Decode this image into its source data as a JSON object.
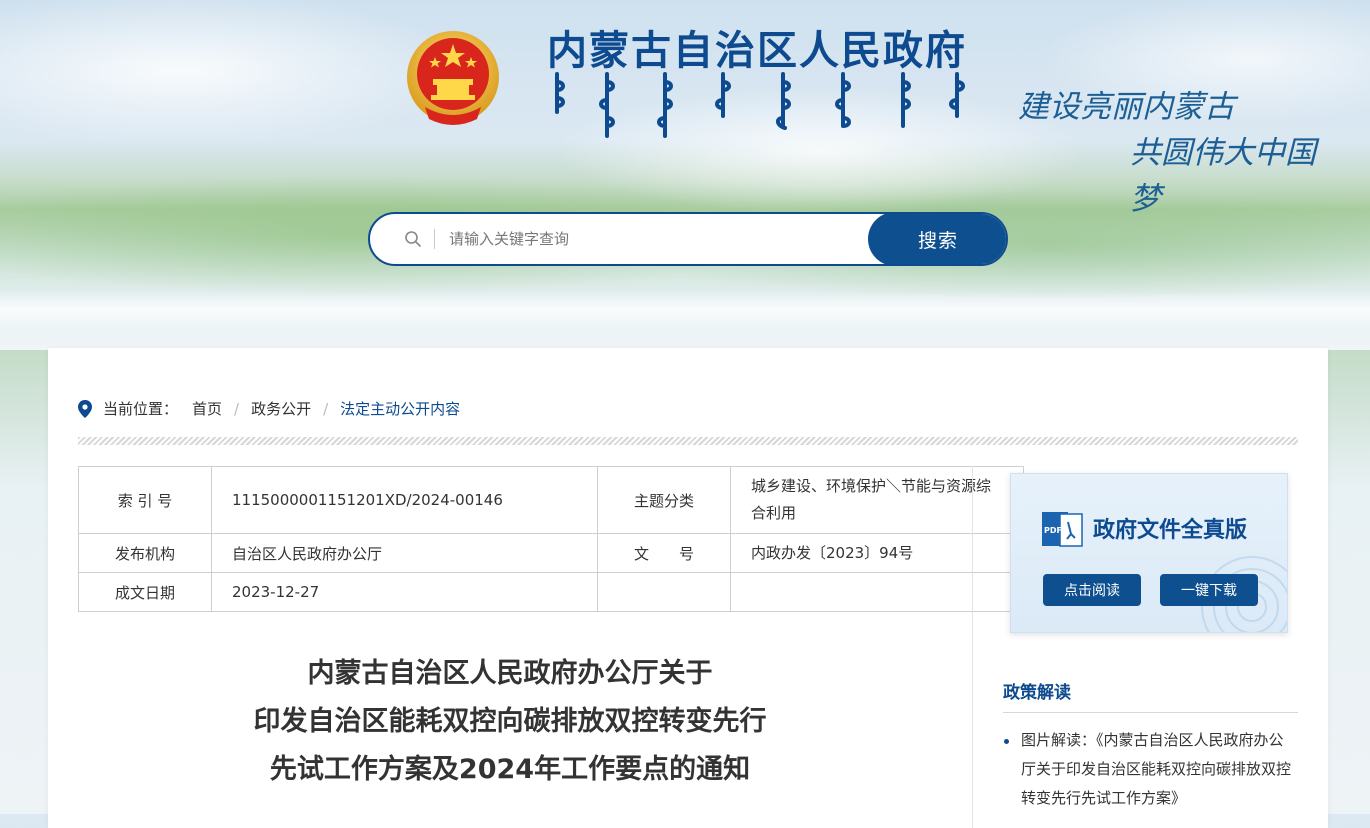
{
  "header": {
    "site_title": "内蒙古自治区人民政府",
    "slogan_line1": "建设亮丽内蒙古",
    "slogan_line2": "共圆伟大中国梦"
  },
  "search": {
    "placeholder": "请输入关键字查询",
    "button_label": "搜索"
  },
  "breadcrumb": {
    "label": "当前位置：",
    "items": [
      "首页",
      "政务公开",
      "法定主动公开内容"
    ]
  },
  "meta": {
    "index_label": "索 引 号",
    "index_value": "1115000001151201XD/2024-00146",
    "topic_label": "主题分类",
    "topic_value": "城乡建设、环境保护＼节能与资源综合利用",
    "issuer_label": "发布机构",
    "issuer_value": "自治区人民政府办公厅",
    "docno_label": "文　　号",
    "docno_value": "内政办发〔2023〕94号",
    "date_label": "成文日期",
    "date_value": "2023-12-27"
  },
  "document": {
    "title_lines": [
      "内蒙古自治区人民政府办公厅关于",
      "印发自治区能耗双控向碳排放双控转变先行",
      "先试工作方案及2024年工作要点的通知"
    ]
  },
  "full_version": {
    "title": "政府文件全真版",
    "pdf_badge": "PDF",
    "read_label": "点击阅读",
    "download_label": "一键下载"
  },
  "policy": {
    "heading": "政策解读",
    "items": [
      "图片解读：《内蒙古自治区人民政府办公厅关于印发自治区能耗双控向碳排放双控转变先行先试工作方案》"
    ]
  },
  "colors": {
    "brand": "#0d4a8f",
    "button": "#0d4f8f"
  }
}
